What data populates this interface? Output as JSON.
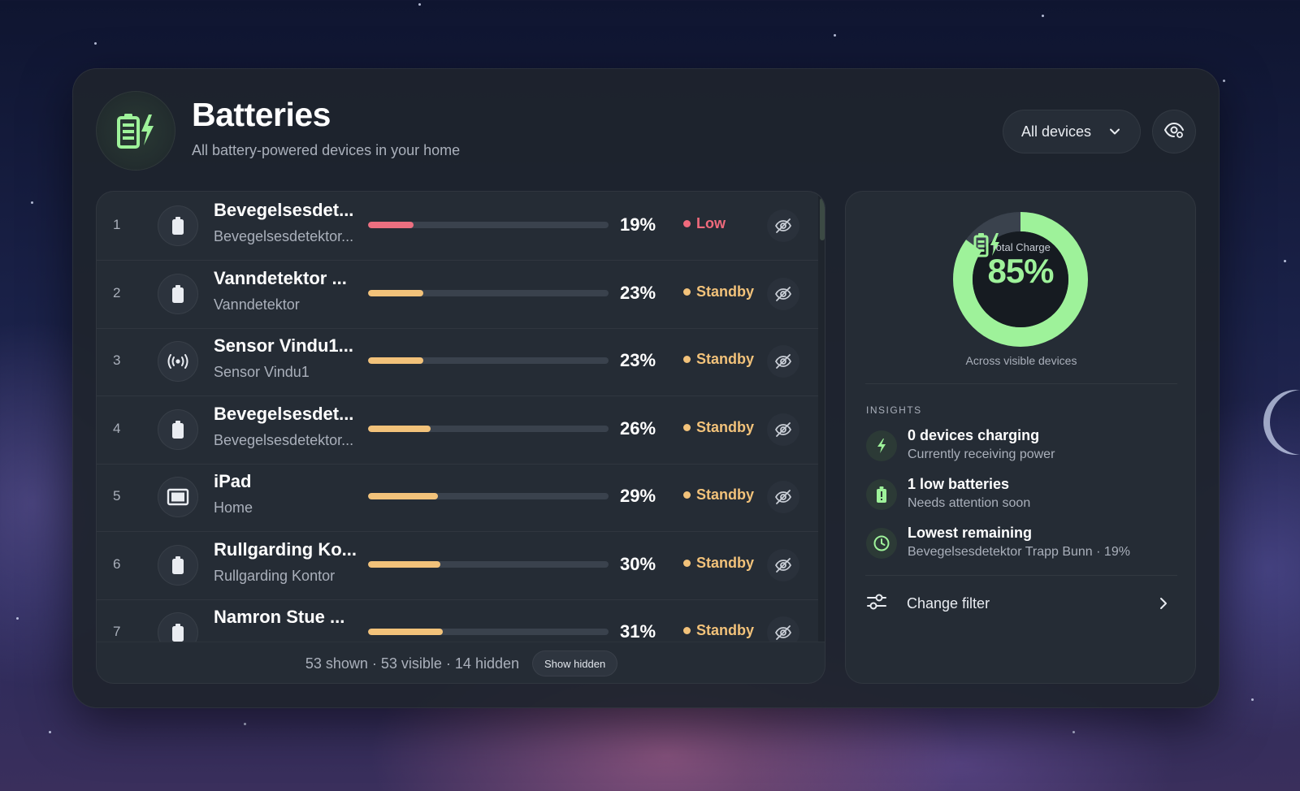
{
  "header": {
    "title": "Batteries",
    "subtitle": "All battery-powered devices in your home",
    "filter_select": "All devices"
  },
  "devices": [
    {
      "index": "1",
      "name": "Bevegelsesdet...",
      "sub": "Bevegelsesdetektor...",
      "percent": "19%",
      "level": 0.19,
      "status": "Low",
      "icon": "battery-icon"
    },
    {
      "index": "2",
      "name": "Vanndetektor ...",
      "sub": "Vanndetektor",
      "percent": "23%",
      "level": 0.23,
      "status": "Standby",
      "icon": "battery-icon"
    },
    {
      "index": "3",
      "name": "Sensor Vindu1...",
      "sub": "Sensor Vindu1",
      "percent": "23%",
      "level": 0.23,
      "status": "Standby",
      "icon": "sensor-signal-icon"
    },
    {
      "index": "4",
      "name": "Bevegelsesdet...",
      "sub": "Bevegelsesdetektor...",
      "percent": "26%",
      "level": 0.26,
      "status": "Standby",
      "icon": "battery-icon"
    },
    {
      "index": "5",
      "name": "iPad",
      "sub": "Home",
      "percent": "29%",
      "level": 0.29,
      "status": "Standby",
      "icon": "tablet-icon"
    },
    {
      "index": "6",
      "name": "Rullgarding Ko...",
      "sub": "Rullgarding Kontor",
      "percent": "30%",
      "level": 0.3,
      "status": "Standby",
      "icon": "battery-icon"
    },
    {
      "index": "7",
      "name": "Namron Stue ...",
      "sub": "",
      "percent": "31%",
      "level": 0.31,
      "status": "Standby",
      "icon": "battery-icon"
    }
  ],
  "list_footer": {
    "summary": "53 shown · 53 visible · 14 hidden",
    "show_hidden_label": "Show hidden"
  },
  "summary": {
    "ring_label": "Total Charge",
    "total_charge": "85%",
    "total_charge_fraction": 0.85,
    "caption": "Across visible devices"
  },
  "insights": {
    "title": "INSIGHTS",
    "items": [
      {
        "title": "0 devices charging",
        "sub": "Currently receiving power",
        "icon": "lightning-icon"
      },
      {
        "title": "1 low batteries",
        "sub": "Needs attention soon",
        "icon": "battery-low-icon"
      },
      {
        "title": "Lowest remaining",
        "sub": "Bevegelsesdetektor Trapp Bunn · 19%",
        "icon": "clock-icon"
      }
    ],
    "change_filter_label": "Change filter"
  },
  "colors": {
    "accent_green": "#9ef29a",
    "low_red": "#f06a7c",
    "standby_orange": "#f2c27a",
    "bar_low": "#ec6f80",
    "bar_standby": "#f2c27a"
  }
}
